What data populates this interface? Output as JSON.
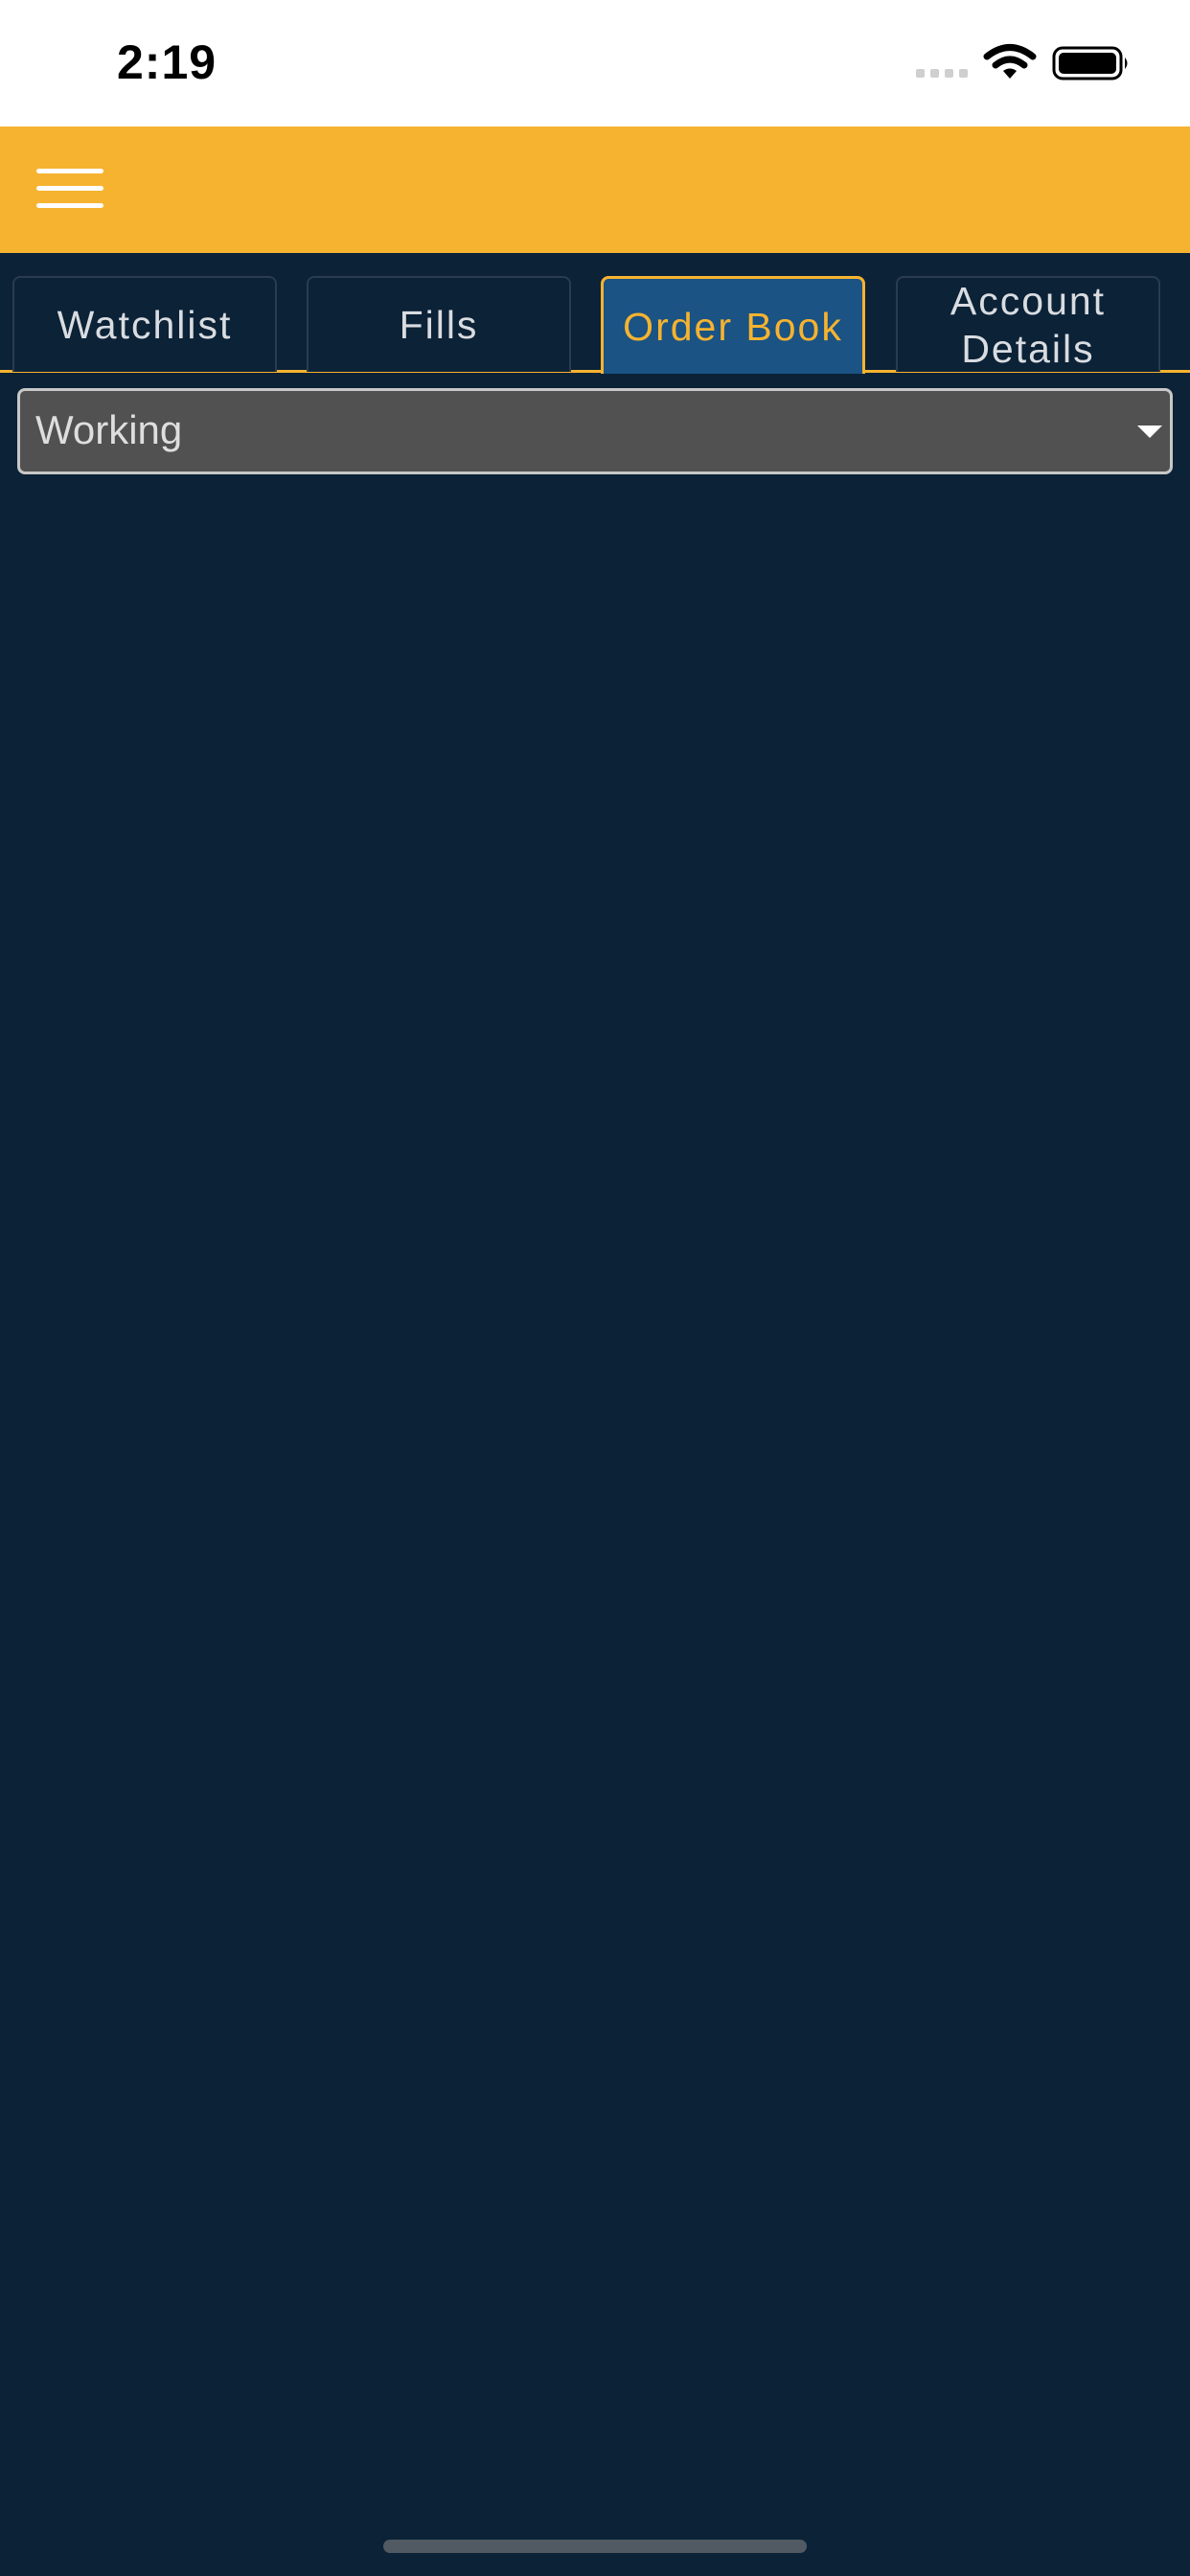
{
  "status_bar": {
    "time": "2:19"
  },
  "tabs": [
    {
      "label": "Watchlist"
    },
    {
      "label": "Fills"
    },
    {
      "label": "Order Book"
    },
    {
      "label": "Account Details"
    }
  ],
  "filter": {
    "selected": "Working"
  },
  "icons": {
    "menu": "hamburger-menu-icon",
    "wifi": "wifi-icon",
    "battery": "battery-icon",
    "dropdown": "chevron-down-icon"
  },
  "colors": {
    "header": "#f6b330",
    "background": "#0b2237",
    "active_tab": "#1a5384",
    "accent": "#f6b330",
    "dropdown": "#515151"
  }
}
